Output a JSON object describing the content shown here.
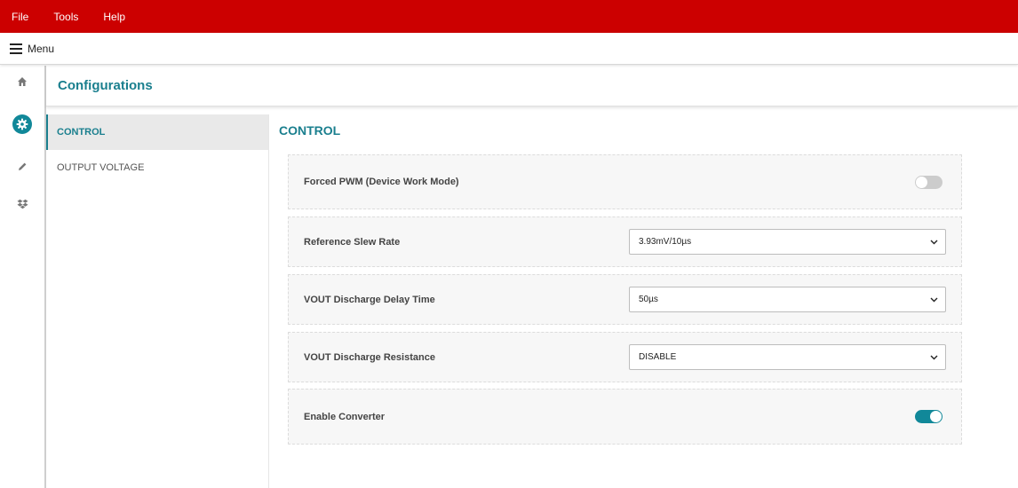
{
  "menubar": {
    "items": [
      "File",
      "Tools",
      "Help"
    ]
  },
  "menurow": {
    "label": "Menu"
  },
  "leftnav": {
    "icons": [
      "home-icon",
      "gear-icon",
      "pencil-icon",
      "dropbox-icon"
    ],
    "active": "gear-icon"
  },
  "header": {
    "title": "Configurations"
  },
  "subnav": {
    "items": [
      {
        "label": "CONTROL",
        "active": true
      },
      {
        "label": "OUTPUT VOLTAGE",
        "active": false
      }
    ]
  },
  "content": {
    "section_title": "CONTROL",
    "rows": [
      {
        "label": "Forced PWM (Device Work Mode)",
        "type": "toggle",
        "state": "off"
      },
      {
        "label": "Reference Slew Rate",
        "type": "select",
        "value": "3.93mV/10µs"
      },
      {
        "label": "VOUT Discharge Delay Time",
        "type": "select",
        "value": "50µs"
      },
      {
        "label": "VOUT Discharge Resistance",
        "type": "select",
        "value": "DISABLE"
      },
      {
        "label": "Enable Converter",
        "type": "toggle",
        "state": "on"
      }
    ]
  },
  "colors": {
    "menubar": "#cc0000",
    "accent": "#1a7f8e",
    "toggle_on": "#118899",
    "toggle_off": "#cccccc"
  }
}
